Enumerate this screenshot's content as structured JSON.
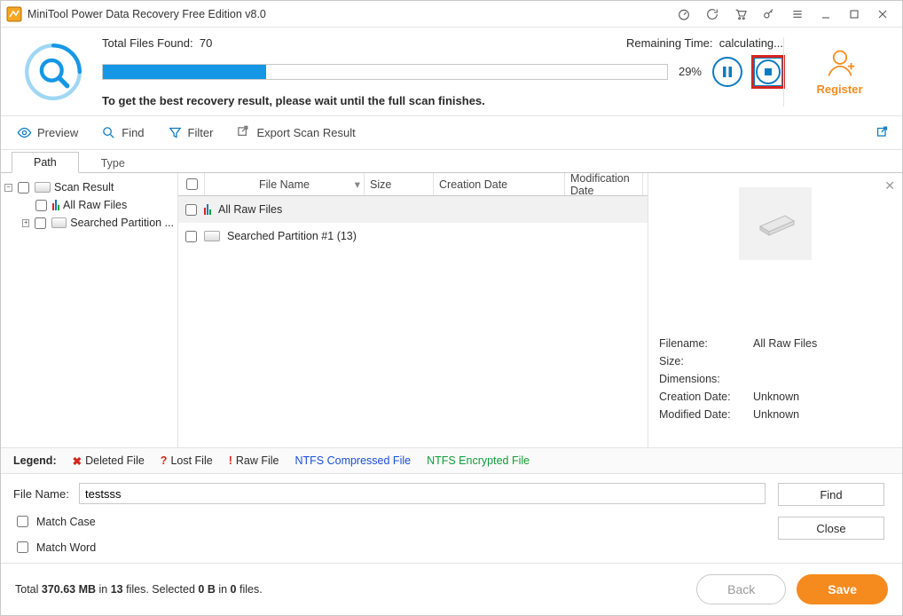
{
  "window": {
    "title": "MiniTool Power Data Recovery Free Edition v8.0"
  },
  "scan": {
    "total_label": "Total Files Found:",
    "total_value": "70",
    "remaining_label": "Remaining Time:",
    "remaining_value": "calculating...",
    "percent": "29%",
    "progress_pct": 29,
    "hint": "To get the best recovery result, please wait until the full scan finishes."
  },
  "register": {
    "label": "Register"
  },
  "toolbar": {
    "preview": "Preview",
    "find": "Find",
    "filter": "Filter",
    "export": "Export Scan Result"
  },
  "tabs": {
    "path": "Path",
    "type": "Type"
  },
  "tree": {
    "root": "Scan Result",
    "items": [
      {
        "label": "All Raw Files"
      },
      {
        "label": "Searched Partition ..."
      }
    ]
  },
  "table": {
    "headers": {
      "name": "File Name",
      "size": "Size",
      "creation": "Creation Date",
      "modification": "Modification Date"
    },
    "rows": [
      {
        "name": "All Raw Files"
      },
      {
        "name": "Searched Partition #1 (13)"
      }
    ]
  },
  "details": {
    "filename_k": "Filename:",
    "filename_v": "All Raw Files",
    "size_k": "Size:",
    "size_v": "",
    "dim_k": "Dimensions:",
    "dim_v": "",
    "cd_k": "Creation Date:",
    "cd_v": "Unknown",
    "md_k": "Modified Date:",
    "md_v": "Unknown"
  },
  "legend": {
    "title": "Legend:",
    "deleted": "Deleted File",
    "lost": "Lost File",
    "raw": "Raw File",
    "ntfs_c": "NTFS Compressed File",
    "ntfs_e": "NTFS Encrypted File"
  },
  "find_panel": {
    "filename_label": "File Name:",
    "filename_value": "testsss",
    "match_case": "Match Case",
    "match_word": "Match Word",
    "find_btn": "Find",
    "close_btn": "Close"
  },
  "footer": {
    "status_prefix": "Total ",
    "status_size": "370.63 MB",
    "status_mid1": " in ",
    "status_files": "13",
    "status_mid2": " files.   Selected ",
    "status_sel_size": "0 B",
    "status_mid3": " in ",
    "status_sel_files": "0",
    "status_suffix": " files.",
    "back": "Back",
    "save": "Save"
  }
}
